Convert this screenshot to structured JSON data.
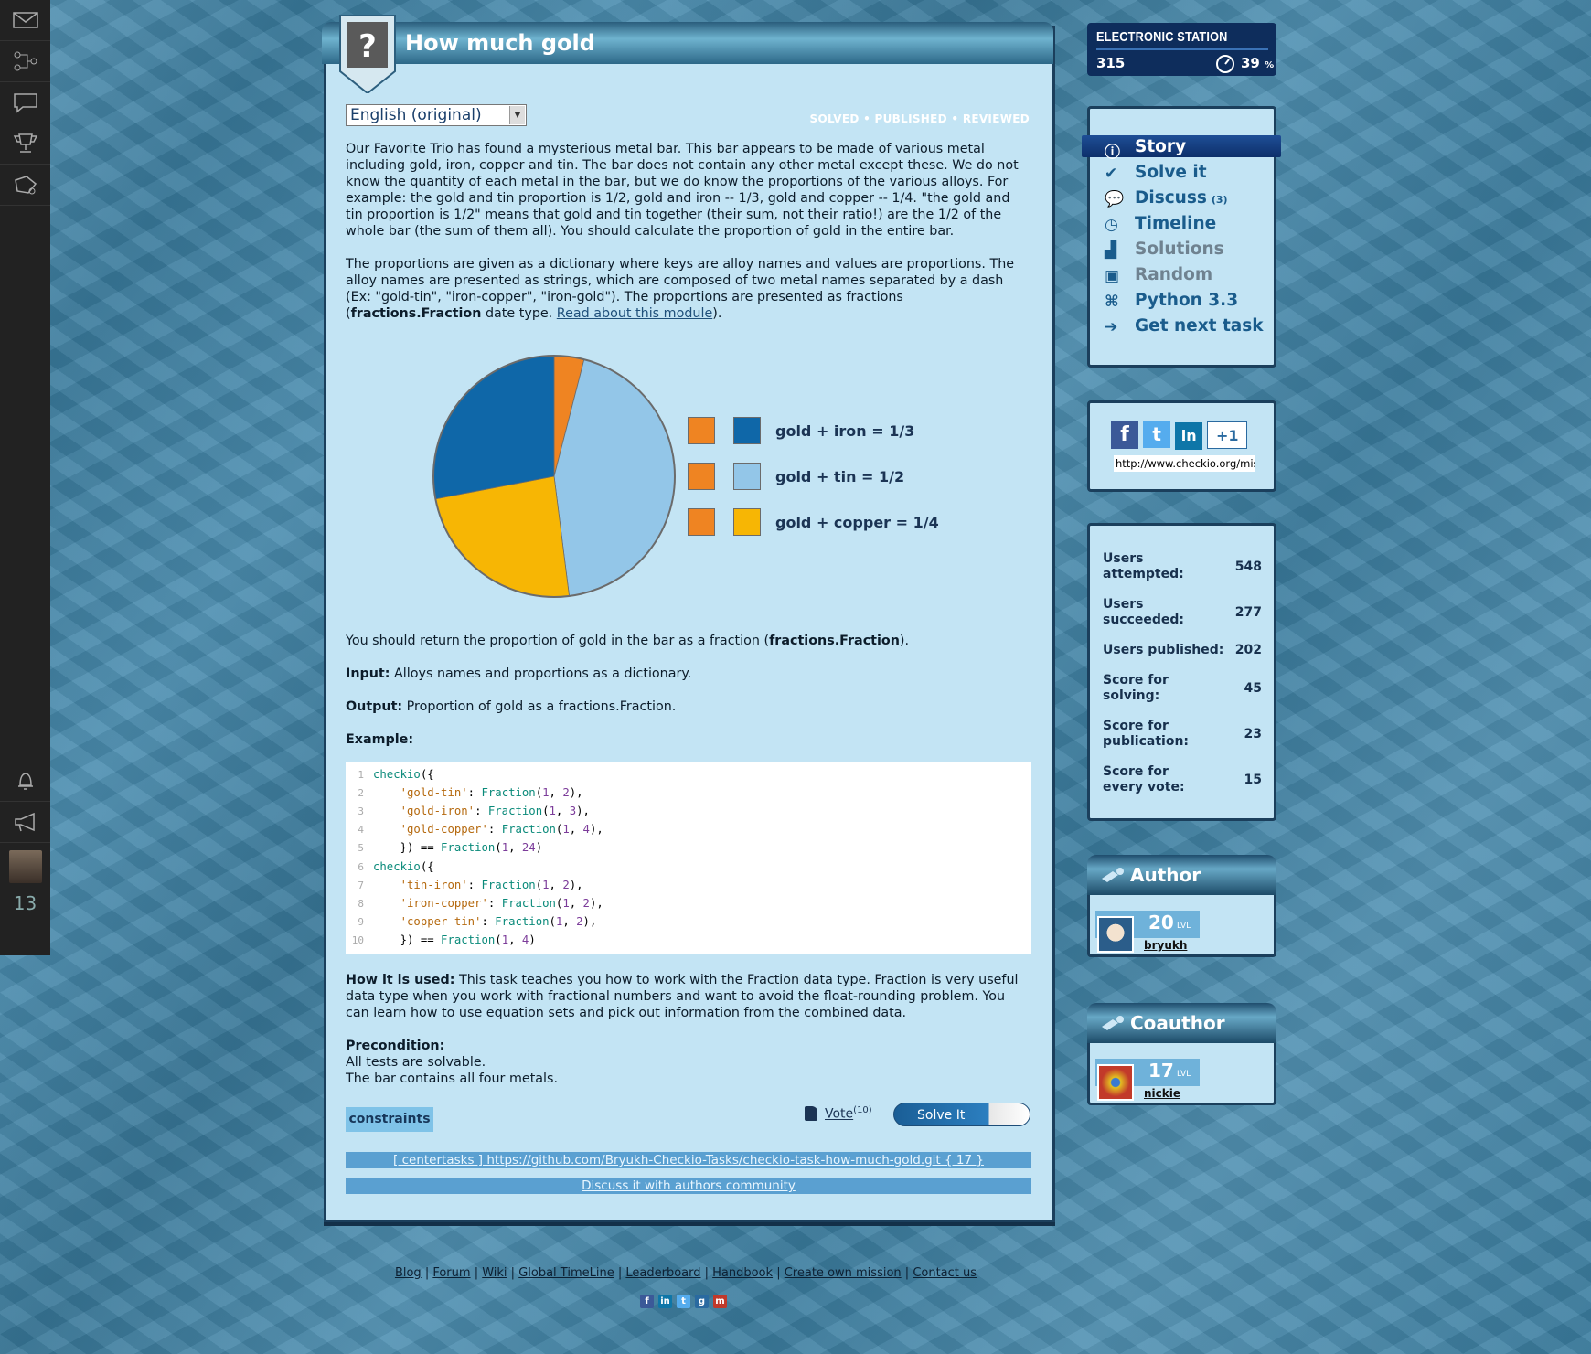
{
  "rail": {
    "icons": [
      "envelope-icon",
      "network-icon",
      "chat-icon",
      "trophy-icon",
      "puzzle-icon",
      "bell-icon",
      "megaphone-icon"
    ],
    "count": "13"
  },
  "task": {
    "title": "How much gold",
    "language": "English (original)",
    "status": [
      "SOLVED",
      "PUBLISHED",
      "REVIEWED"
    ],
    "intro": "Our Favorite Trio has found a mysterious metal bar. This bar appears to be made of various metal including gold, iron, copper and tin. The bar does not contain any other metal except these. We do not know the quantity of each metal in the bar, but we do know the proportions of the various alloys. For example: the gold and tin proportion is 1/2, gold and iron -- 1/3, gold and copper -- 1/4. \"the gold and tin proportion is 1/2\" means that gold and tin together (their sum, not their ratio!) are the 1/2 of the whole bar (the sum of them all). You should calculate the proportion of gold in the entire bar.",
    "props_a": "The proportions are given as a dictionary where keys are alloy names and values are proportions. The alloy names are presented as strings, which are composed of two metal names separated by a dash (Ex: \"gold-tin\", \"iron-copper\", \"iron-gold\"). The proportions are presented as fractions (",
    "props_bold": "fractions.Fraction",
    "props_b": " date type. ",
    "props_link": "Read about this module",
    "props_c": ").",
    "return_a": "You should return the proportion of gold in the bar as a fraction (",
    "return_bold": "fractions.Fraction",
    "return_c": ").",
    "input_label": "Input:",
    "input_text": " Alloys names and proportions as a dictionary.",
    "output_label": "Output:",
    "output_text": " Proportion of gold as a fractions.Fraction.",
    "example_label": "Example:",
    "how_label": "How it is used:",
    "how_text": " This task teaches you how to work with the Fraction data type. Fraction is very useful data type when you work with fractional numbers and want to avoid the float-rounding problem. You can learn how to use equation sets and pick out information from the combined data.",
    "precondition_label": "Precondition:",
    "precondition_lines": [
      "All tests are solvable.",
      "The bar contains all four metals."
    ],
    "constraints": "constraints",
    "vote_label": "Vote",
    "vote_count": "(10)",
    "solve_label": "Solve It",
    "repo_link": "[ centertasks ] https://github.com/Bryukh-Checkio-Tasks/checkio-task-how-much-gold.git { 17 }",
    "discuss_link": "Discuss it with authors community"
  },
  "code_lines": [
    {
      "n": "1",
      "t": "checkio({"
    },
    {
      "n": "2",
      "t": "    'gold-tin': Fraction(1, 2),"
    },
    {
      "n": "3",
      "t": "    'gold-iron': Fraction(1, 3),"
    },
    {
      "n": "4",
      "t": "    'gold-copper': Fraction(1, 4),"
    },
    {
      "n": "5",
      "t": "    }) == Fraction(1, 24)"
    },
    {
      "n": "6",
      "t": "checkio({"
    },
    {
      "n": "7",
      "t": "    'tin-iron': Fraction(1, 2),"
    },
    {
      "n": "8",
      "t": "    'iron-copper': Fraction(1, 2),"
    },
    {
      "n": "9",
      "t": "    'copper-tin': Fraction(1, 2),"
    },
    {
      "n": "10",
      "t": "    }) == Fraction(1, 4)"
    }
  ],
  "chart_data": {
    "type": "pie",
    "slices": [
      {
        "label": "gold",
        "value": 1,
        "color": "#ef8422"
      },
      {
        "label": "tin",
        "value": 11,
        "color": "#93c6e8"
      },
      {
        "label": "copper",
        "value": 6,
        "color": "#f7b604"
      },
      {
        "label": "iron",
        "value": 7,
        "color": "#0f67a8"
      }
    ],
    "legend": [
      {
        "text": "gold + iron = 1/3",
        "colors": [
          "#ef8422",
          "#0f67a8"
        ]
      },
      {
        "text": "gold + tin = 1/2",
        "colors": [
          "#ef8422",
          "#93c6e8"
        ]
      },
      {
        "text": "gold + copper = 1/4",
        "colors": [
          "#ef8422",
          "#f7b604"
        ]
      }
    ]
  },
  "station": {
    "title": "ELECTRONIC STATION",
    "points": "315",
    "percent": "39",
    "percent_unit": "%"
  },
  "menu": [
    {
      "label": "Story",
      "icon": "info-icon"
    },
    {
      "label": "Solve it",
      "icon": "checkmark-icon"
    },
    {
      "label": "Discuss",
      "count": "(3)",
      "icon": "speech-bubble-icon"
    },
    {
      "label": "Timeline",
      "icon": "clock-icon"
    },
    {
      "label": "Solutions",
      "icon": "podium-icon"
    },
    {
      "label": "Random",
      "icon": "cube-icon"
    },
    {
      "label": "Python 3.3",
      "icon": "python-icon"
    },
    {
      "label": "Get next task",
      "icon": "arrow-right-icon"
    }
  ],
  "share": {
    "url": "http://www.checkio.org/mis",
    "networks": [
      "f",
      "t",
      "in",
      "+1"
    ]
  },
  "stats": [
    {
      "label": "Users attempted:",
      "value": "548"
    },
    {
      "label": "Users succeeded:",
      "value": "277"
    },
    {
      "label": "Users published:",
      "value": "202"
    },
    {
      "label": "Score for solving:",
      "value": "45"
    },
    {
      "label": "Score for publication:",
      "value": "23"
    },
    {
      "label": "Score for every vote:",
      "value": "15"
    }
  ],
  "author": {
    "heading": "Author",
    "level": "20",
    "level_label": "LVL",
    "name": "bryukh"
  },
  "coauthor": {
    "heading": "Coauthor",
    "level": "17",
    "level_label": "LVL",
    "name": "nickie"
  },
  "footer": {
    "links": [
      "Blog",
      "Forum",
      "Wiki",
      "Global TimeLine",
      "Leaderboard",
      "Handbook",
      "Create own mission",
      "Contact us"
    ],
    "icons": [
      "f",
      "in",
      "t",
      "g",
      "m"
    ]
  },
  "colors": {
    "panel": "#c3e4f4",
    "accent": "#1a5c8c",
    "dark": "#1b3f5c"
  }
}
